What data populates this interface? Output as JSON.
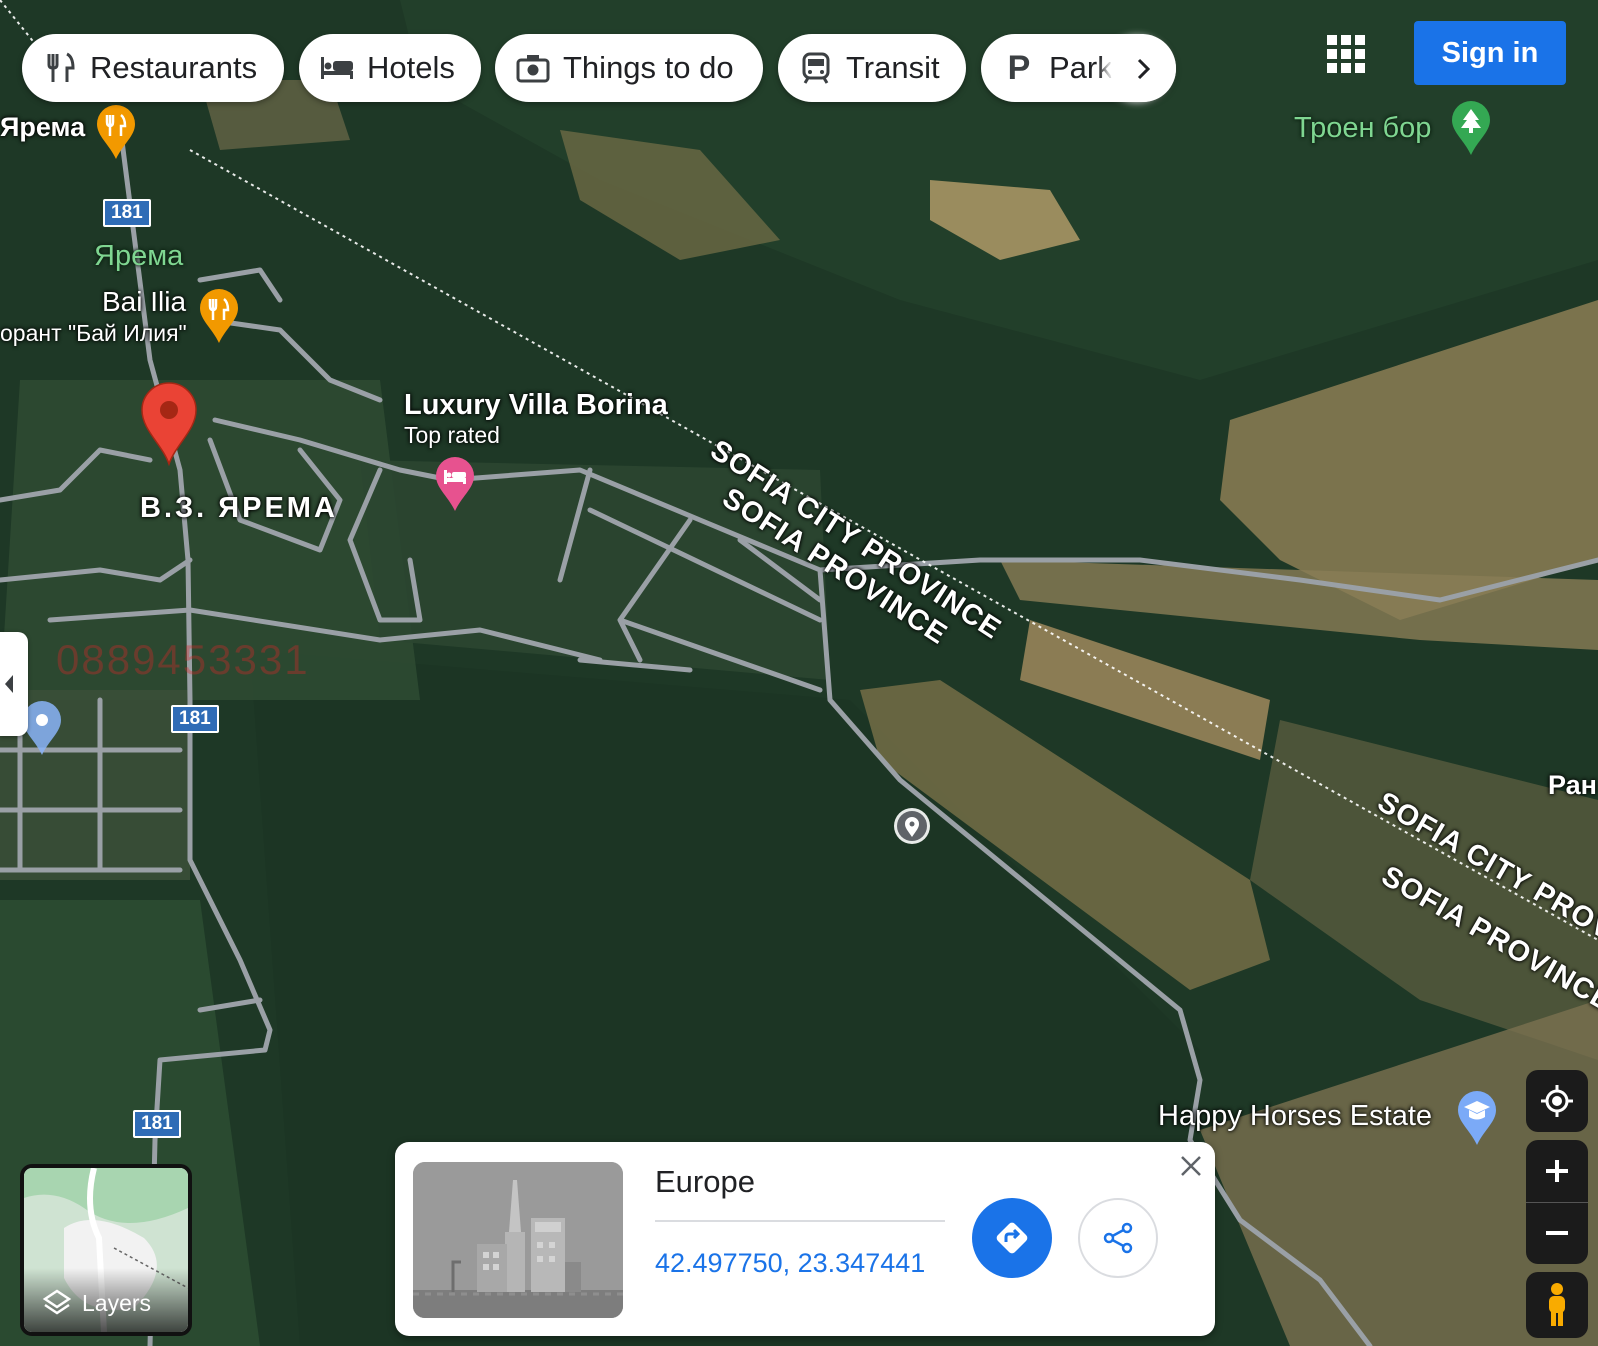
{
  "chips": [
    {
      "label": "Restaurants",
      "icon": "fork-knife-icon"
    },
    {
      "label": "Hotels",
      "icon": "bed-icon"
    },
    {
      "label": "Things to do",
      "icon": "camera-icon"
    },
    {
      "label": "Transit",
      "icon": "train-icon"
    },
    {
      "label": "Park",
      "icon": "parking-icon"
    }
  ],
  "header": {
    "sign_in": "Sign in",
    "apps_icon": "apps-grid-icon"
  },
  "map_labels": {
    "yarema_top": "Ярема",
    "yarema_green": "Ярема",
    "bai_ilia": "Bai Ilia",
    "bai_ilia_sub": "орант \"Бай Илия\"",
    "villa": "Luxury Villa Borina",
    "villa_sub": "Top rated",
    "vz_yarema": "В.З. ЯРЕМА",
    "troen_bor": "Троен бор",
    "happy_horses": "Happy Horses Estate",
    "ran": "Ран",
    "watermark": "0889453331",
    "province_city_1": "SOFIA CITY PROVINCE",
    "province_1": "SOFIA PROVINCE",
    "province_city_2": "SOFIA CITY PROVINCE",
    "province_2": "SOFIA PROVINCE"
  },
  "route_shields": [
    "181",
    "181",
    "181"
  ],
  "card": {
    "title": "Europe",
    "coords": "42.497750, 23.347441",
    "directions_icon": "directions-icon",
    "share_icon": "share-icon",
    "close_icon": "close-icon"
  },
  "layers": {
    "label": "Layers"
  },
  "colors": {
    "accent": "#1a73e8",
    "pin_red": "#ea4335",
    "restaurant": "#f29900",
    "hotel": "#e7528f",
    "park_green": "#34a853"
  }
}
